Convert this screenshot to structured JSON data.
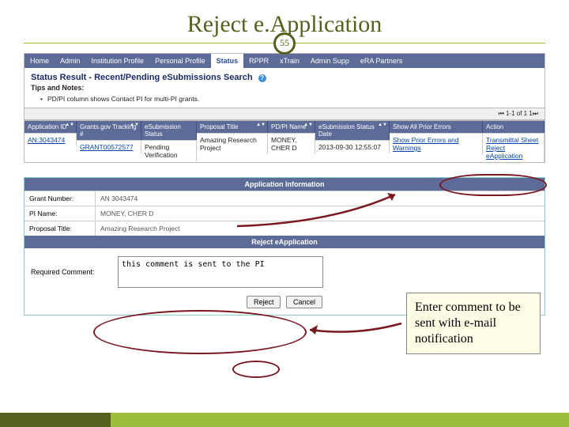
{
  "title": "Reject e.Application",
  "slide_number": "55",
  "nav": {
    "items": [
      "Home",
      "Admin",
      "Institution Profile",
      "Personal Profile",
      "Status",
      "RPPR",
      "xTrain",
      "Admin Supp",
      "eRA Partners"
    ],
    "active_index": 4
  },
  "panel1": {
    "heading": "Status Result - Recent/Pending eSubmissions Search",
    "tips_label": "Tips and Notes:",
    "bullet": "PD/PI column shows Contact PI for multi-PI grants.",
    "pager": "⏮ 1-1 of 1   1⏭",
    "columns": [
      "Application ID",
      "Grants.gov Tracking #",
      "eSubmission Status",
      "Proposal Title",
      "PD/PI Name",
      "eSubmission Status Date",
      "Show All Prior Errors",
      "Action"
    ],
    "row": {
      "app_id": "AN:3043474",
      "tracking": "GRANT00572577",
      "esub_status": "Pending Verification",
      "proposal": "Amazing Research Project",
      "pdpi": "MONEY, CHER D",
      "date": "2013-09-30 12:55:07",
      "prior": "Show Prior Errors and Warnings",
      "actions": "Transmittal Sheet   Reject eApplication"
    }
  },
  "panel2": {
    "info_header": "Application Information",
    "grant_label": "Grant Number:",
    "grant_value": "AN 3043474",
    "pi_label": "PI Name:",
    "pi_value": "MONEY, CHER D",
    "prop_label": "Proposal Title:",
    "prop_value": "Amazing Research Project",
    "reject_header": "Reject eApplication",
    "comment_label": "Required Comment:",
    "comment_value": "this comment is sent to the PI",
    "btn_reject": "Reject",
    "btn_cancel": "Cancel"
  },
  "callout": "Enter comment to be sent with e-mail notification"
}
